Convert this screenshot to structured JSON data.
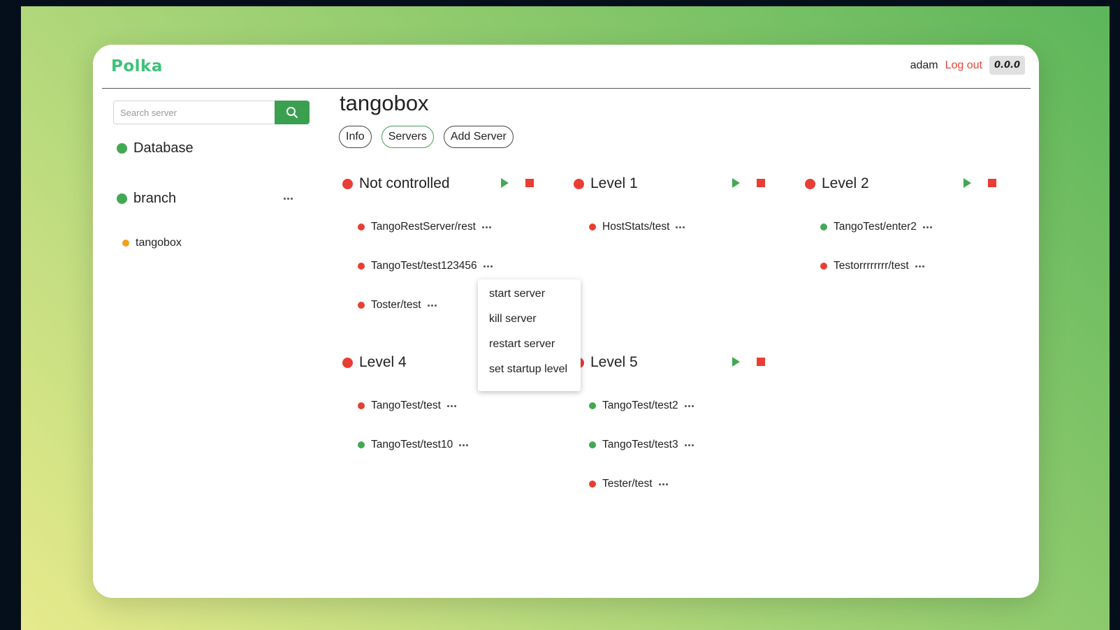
{
  "app": {
    "logo": "Polka",
    "user": "adam",
    "logout_label": "Log out",
    "version": "0.0.0"
  },
  "search": {
    "placeholder": "Search server"
  },
  "sidebar": {
    "items": [
      {
        "label": "Database",
        "status": "green"
      },
      {
        "label": "branch",
        "status": "green"
      },
      {
        "label": "tangobox",
        "status": "orange"
      }
    ]
  },
  "main": {
    "title": "tangobox",
    "tabs": [
      "Info",
      "Servers",
      "Add Server"
    ],
    "active_tab": "Servers"
  },
  "groups": [
    {
      "label": "Not controlled",
      "servers": [
        {
          "name": "TangoRestServer/rest",
          "status": "red"
        },
        {
          "name": "TangoTest/test123456",
          "status": "red"
        },
        {
          "name": "Toster/test",
          "status": "red"
        }
      ]
    },
    {
      "label": "Level 1",
      "servers": [
        {
          "name": "HostStats/test",
          "status": "red"
        }
      ]
    },
    {
      "label": "Level 2",
      "servers": [
        {
          "name": "TangoTest/enter2",
          "status": "green"
        },
        {
          "name": "Testorrrrrrrr/test",
          "status": "red"
        }
      ]
    },
    {
      "label": "Level 4",
      "servers": [
        {
          "name": "TangoTest/test",
          "status": "red"
        },
        {
          "name": "TangoTest/test10",
          "status": "green"
        }
      ]
    },
    {
      "label": "Level 5",
      "servers": [
        {
          "name": "TangoTest/test2",
          "status": "green"
        },
        {
          "name": "TangoTest/test3",
          "status": "green"
        },
        {
          "name": "Tester/test",
          "status": "red"
        }
      ]
    }
  ],
  "context_menu": {
    "items": [
      "start server",
      "kill server",
      "restart server",
      "set startup level"
    ]
  },
  "icons": {
    "search": "search-icon",
    "more": "more-dots-icon",
    "start": "play-icon",
    "stop": "stop-icon"
  },
  "colors": {
    "accent_green": "#43a854",
    "status_red": "#ea3d33",
    "status_orange": "#f3a11a",
    "logo_green": "#3ec278",
    "logout_red": "#e8443a"
  }
}
